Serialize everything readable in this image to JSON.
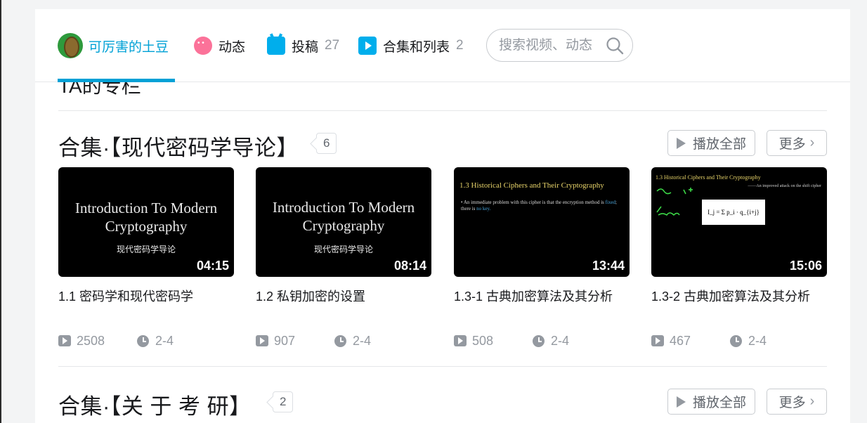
{
  "nav": {
    "user_name": "可厉害的土豆",
    "dynamic_label": "动态",
    "upload_label": "投稿",
    "upload_count": "27",
    "collections_label": "合集和列表",
    "collections_count": "2",
    "search_placeholder": "搜索视频、动态"
  },
  "partial_heading": "TA的专栏",
  "collection1": {
    "title": "合集·【现代密码学导论】",
    "count": "6",
    "play_all_label": "播放全部",
    "more_label": "更多",
    "videos": [
      {
        "slide_line1": "Introduction To Modern",
        "slide_line2": "Cryptography",
        "slide_sub": "现代密码学导论",
        "duration": "04:15",
        "title": "1.1 密码学和现代密码学",
        "views": "2508",
        "date": "2-4"
      },
      {
        "slide_line1": "Introduction To Modern",
        "slide_line2": "Cryptography",
        "slide_sub": "现代密码学导论",
        "duration": "08:14",
        "title": "1.2 私钥加密的设置",
        "views": "907",
        "date": "2-4"
      },
      {
        "slide_heading": "1.3 Historical Ciphers and Their Cryptography",
        "slide_body_1": "• An immediate problem with this cipher is that the encryption method is",
        "slide_body_2": "fixed",
        "slide_body_3": "; there is",
        "slide_body_4": "no key.",
        "duration": "13:44",
        "title": "1.3-1 古典加密算法及其分析",
        "views": "508",
        "date": "2-4"
      },
      {
        "slide_heading": "1.3 Historical Ciphers and Their Cryptography",
        "slide_subheading": "——An improved attack on the shift cipher",
        "formula": "I_j = Σ p_i · q_{i+j}",
        "duration": "15:06",
        "title": "1.3-2 古典加密算法及其分析",
        "views": "467",
        "date": "2-4"
      }
    ]
  },
  "collection2": {
    "title": "合集·【关 于 考 研】",
    "count": "2",
    "play_all_label": "播放全部",
    "more_label": "更多"
  },
  "colors": {
    "accent": "#00a1d6",
    "pink": "#fb7299",
    "muted": "#9499a0"
  }
}
